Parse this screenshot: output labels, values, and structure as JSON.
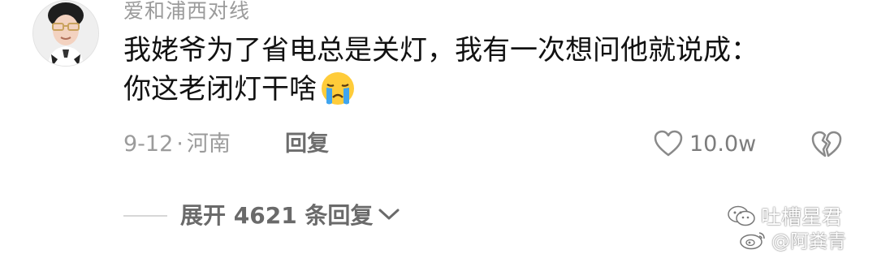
{
  "comment": {
    "username": "爱和浦西对线",
    "text_line1": "我姥爷为了省电总是关灯，我有一次想问他就说成：",
    "text_line2": "你这老闭灯干啥",
    "emoji": "crying-face-emoji",
    "date": "9-12",
    "separator": "·",
    "location": "河南",
    "reply_label": "回复",
    "like_count": "10.0w",
    "expand_label": "展开 4621 条回复"
  },
  "icons": {
    "like": "heart-outline-icon",
    "dislike": "broken-heart-icon",
    "expand": "chevron-down-icon"
  },
  "watermarks": {
    "wechat": "吐槽星君",
    "weibo": "@阿粪青"
  },
  "colors": {
    "text_primary": "#111111",
    "text_secondary": "#9b9b9b",
    "background": "#ffffff"
  }
}
